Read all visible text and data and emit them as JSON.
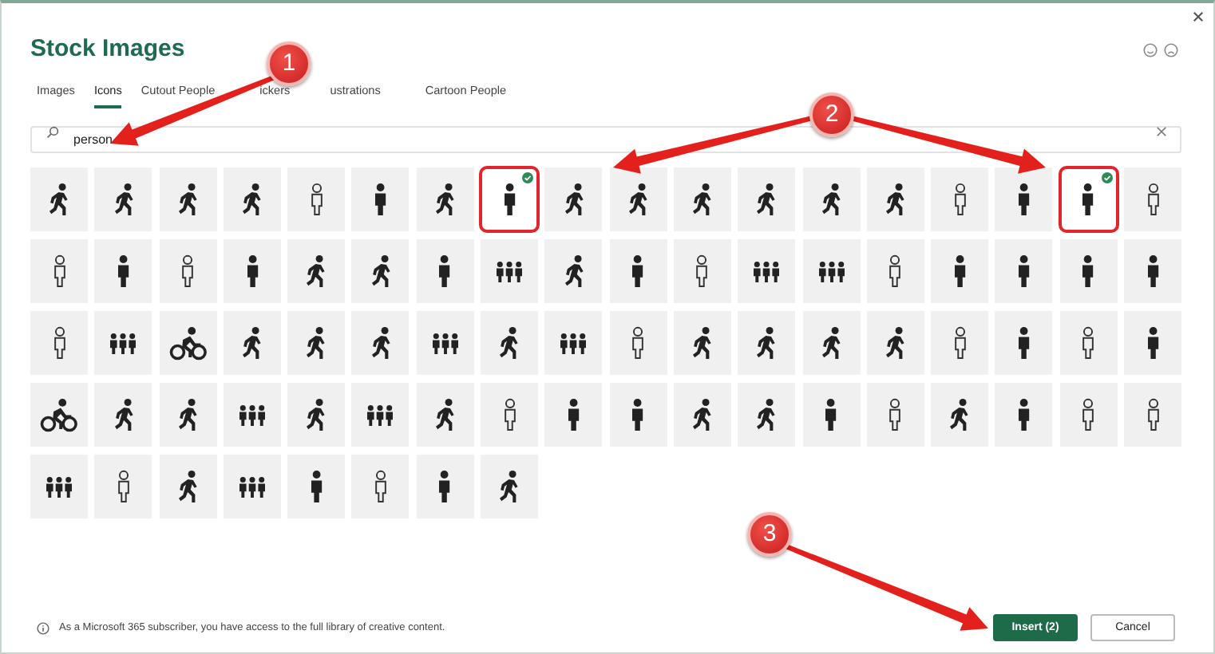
{
  "dialog": {
    "title": "Stock Images"
  },
  "tabs": [
    {
      "label": "Images",
      "selected": false
    },
    {
      "label": "Icons",
      "selected": true
    },
    {
      "label": "Cutout People",
      "selected": false
    },
    {
      "label": "ickers",
      "selected": false
    },
    {
      "label": "ustrations",
      "selected": false
    },
    {
      "label": "Cartoon People",
      "selected": false
    }
  ],
  "search": {
    "value": "person"
  },
  "tiles": [
    {
      "selected": false
    },
    {
      "selected": false
    },
    {
      "selected": false
    },
    {
      "selected": false
    },
    {
      "selected": false
    },
    {
      "selected": false
    },
    {
      "selected": false
    },
    {
      "selected": true
    },
    {
      "selected": false
    },
    {
      "selected": false
    },
    {
      "selected": false
    },
    {
      "selected": false
    },
    {
      "selected": false
    },
    {
      "selected": false
    },
    {
      "selected": false
    },
    {
      "selected": false
    },
    {
      "selected": true
    },
    {
      "selected": false
    },
    {
      "selected": false
    },
    {
      "selected": false
    },
    {
      "selected": false
    },
    {
      "selected": false
    },
    {
      "selected": false
    },
    {
      "selected": false
    },
    {
      "selected": false
    },
    {
      "selected": false
    },
    {
      "selected": false
    },
    {
      "selected": false
    },
    {
      "selected": false
    },
    {
      "selected": false
    },
    {
      "selected": false
    },
    {
      "selected": false
    },
    {
      "selected": false
    },
    {
      "selected": false
    },
    {
      "selected": false
    },
    {
      "selected": false
    },
    {
      "selected": false
    },
    {
      "selected": false
    },
    {
      "selected": false
    },
    {
      "selected": false
    },
    {
      "selected": false
    },
    {
      "selected": false
    },
    {
      "selected": false
    },
    {
      "selected": false
    },
    {
      "selected": false
    },
    {
      "selected": false
    },
    {
      "selected": false
    },
    {
      "selected": false
    },
    {
      "selected": false
    },
    {
      "selected": false
    },
    {
      "selected": false
    },
    {
      "selected": false
    },
    {
      "selected": false
    },
    {
      "selected": false
    },
    {
      "selected": false
    },
    {
      "selected": false
    },
    {
      "selected": false
    },
    {
      "selected": false
    },
    {
      "selected": false
    },
    {
      "selected": false
    },
    {
      "selected": false
    },
    {
      "selected": false
    },
    {
      "selected": false
    },
    {
      "selected": false
    },
    {
      "selected": false
    },
    {
      "selected": false
    },
    {
      "selected": false
    },
    {
      "selected": false
    },
    {
      "selected": false
    },
    {
      "selected": false
    },
    {
      "selected": false
    },
    {
      "selected": false
    },
    {
      "selected": false
    },
    {
      "selected": false
    },
    {
      "selected": false
    },
    {
      "selected": false
    },
    {
      "selected": false
    },
    {
      "selected": false
    },
    {
      "selected": false
    },
    {
      "selected": false
    }
  ],
  "footer": {
    "note": "As a Microsoft 365 subscriber, you have access to the full library of creative content.",
    "buttons": [
      {
        "label": "Insert (2)",
        "kind": "primary"
      },
      {
        "label": "Cancel",
        "kind": "secondary"
      }
    ]
  },
  "annotations": [
    {
      "label": "1"
    },
    {
      "label": "2"
    },
    {
      "label": "3"
    }
  ]
}
